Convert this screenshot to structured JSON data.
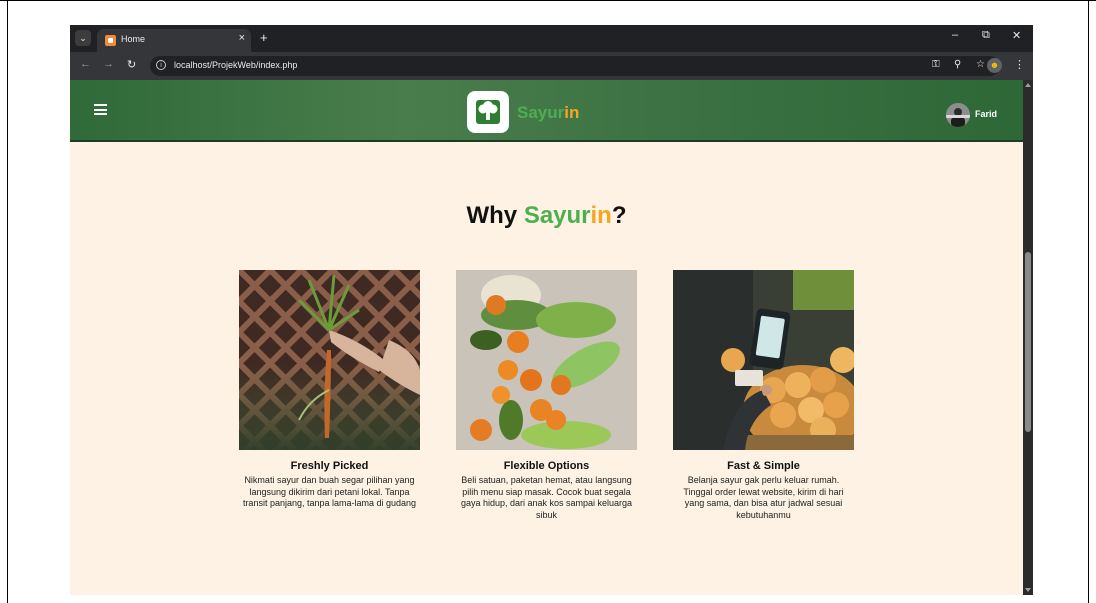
{
  "browser": {
    "tab_title": "Home",
    "tab_close": "×",
    "new_tab": "+",
    "url": "localhost/ProjekWeb/index.php",
    "win_minimize": "–",
    "win_restore": "⧉",
    "win_close": "✕"
  },
  "site": {
    "brand_part1": "Sayur",
    "brand_part2": "in",
    "user_name": "Farid",
    "colors": {
      "header": "#3b7143",
      "background": "#fdf2e3",
      "brand_green": "#4caf50",
      "brand_orange": "#f5a623"
    }
  },
  "section": {
    "title_prefix": "Why ",
    "title_green": "Sayur",
    "title_orange": "in",
    "title_suffix": "?"
  },
  "cards": [
    {
      "title": "Freshly Picked",
      "desc": "Nikmati sayur dan buah segar pilihan yang langsung dikirim dari petani lokal. Tanpa transit panjang, tanpa lama-lama di gudang",
      "image": "carrot-harvest-photo"
    },
    {
      "title": "Flexible Options",
      "desc": "Beli satuan, paketan hemat, atau langsung pilih menu siap masak. Cocok buat segala gaya hidup, dari anak kos sampai keluarga sibuk",
      "image": "vegetables-oranges-photo"
    },
    {
      "title": "Fast & Simple",
      "desc": "Belanja sayur gak perlu keluar rumah. Tinggal order lewat website, kirim di hari yang sama, dan bisa atur jadwal sesuai kebutuhanmu",
      "image": "card-payment-market-photo"
    }
  ]
}
